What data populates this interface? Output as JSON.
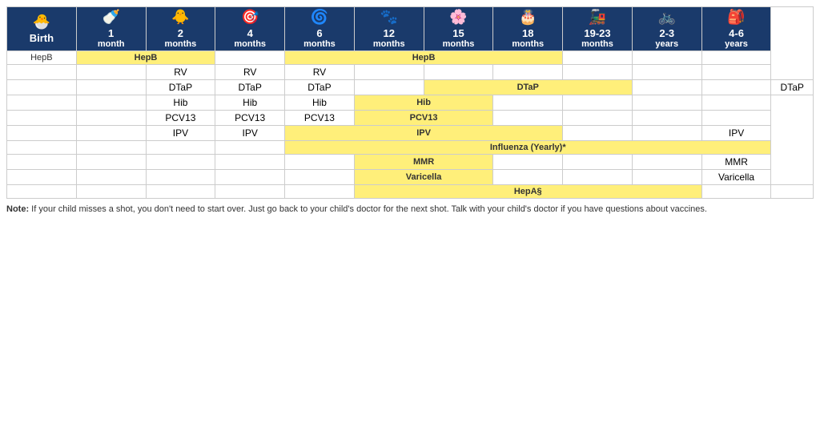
{
  "headers": [
    {
      "icon": "🐣",
      "line1": "Birth",
      "line2": ""
    },
    {
      "icon": "🍼",
      "line1": "1",
      "line2": "month"
    },
    {
      "icon": "🐥",
      "line1": "2",
      "line2": "months"
    },
    {
      "icon": "🎯",
      "line1": "4",
      "line2": "months"
    },
    {
      "icon": "🌀",
      "line1": "6",
      "line2": "months"
    },
    {
      "icon": "🐾",
      "line1": "12",
      "line2": "months"
    },
    {
      "icon": "🌸",
      "line1": "15",
      "line2": "months"
    },
    {
      "icon": "🎂",
      "line1": "18",
      "line2": "months"
    },
    {
      "icon": "🚂",
      "line1": "19-23",
      "line2": "months"
    },
    {
      "icon": "🚲",
      "line1": "2-3",
      "line2": "years"
    },
    {
      "icon": "🎒",
      "line1": "4-6",
      "line2": "years"
    }
  ],
  "vaccines": [
    {
      "name": "HepB",
      "cells": [
        {
          "type": "label",
          "text": "HepB"
        },
        {
          "type": "yellow",
          "text": "HepB",
          "colspan": 2
        },
        {
          "type": "empty"
        },
        {
          "type": "yellow",
          "text": "HepB",
          "colspan": 4
        },
        {
          "type": "empty"
        },
        {
          "type": "empty"
        },
        {
          "type": "empty"
        }
      ]
    }
  ],
  "note": {
    "bold_part": "Note:",
    "text": " If your child misses a shot, you don't need to start over. Just go back to your child's doctor for the next shot. Talk with your child's doctor if you have questions about vaccines."
  }
}
